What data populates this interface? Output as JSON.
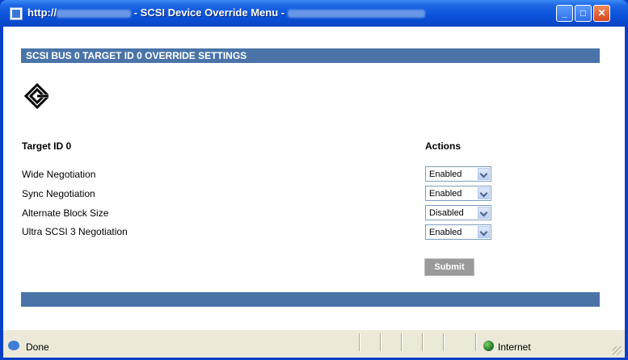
{
  "window": {
    "title_prefix": "http://",
    "title_suffix": " - SCSI Device Override Menu - ",
    "minimize": "_",
    "maximize": "□",
    "close": "✕"
  },
  "page": {
    "header": "SCSI BUS 0 TARGET ID 0 OVERRIDE SETTINGS",
    "logo_icon": "diamond-logo-icon",
    "target_label": "Target ID 0",
    "actions_label": "Actions",
    "settings": [
      {
        "label": "Wide Negotiation",
        "value": "Enabled"
      },
      {
        "label": "Sync Negotiation",
        "value": "Enabled"
      },
      {
        "label": "Alternate Block Size",
        "value": "Disabled"
      },
      {
        "label": "Ultra SCSI 3 Negotiation",
        "value": "Enabled"
      }
    ],
    "submit_label": "Submit"
  },
  "status": {
    "text": "Done",
    "zone": "Internet"
  }
}
